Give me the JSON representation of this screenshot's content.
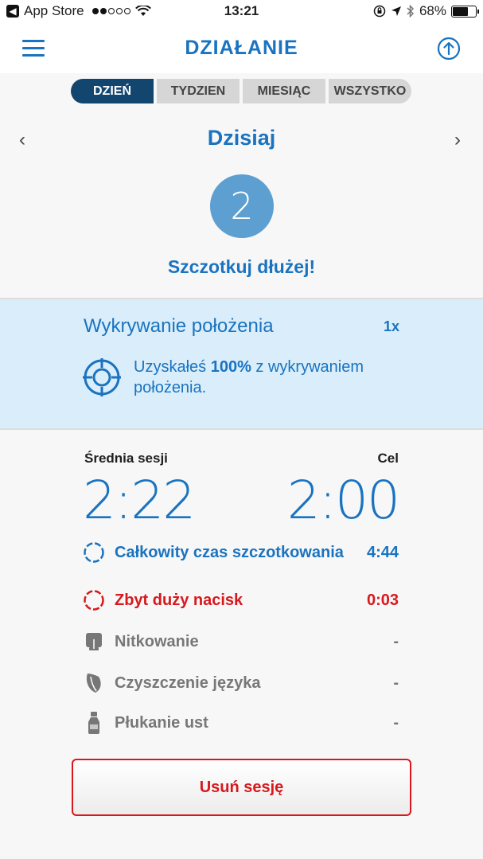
{
  "status_bar": {
    "app": "App Store",
    "time": "13:21",
    "battery": "68%"
  },
  "header": {
    "title": "DZIAŁANIE"
  },
  "tabs": [
    {
      "label": "DZIEŃ"
    },
    {
      "label": "TYDZIEN"
    },
    {
      "label": "MIESIĄC"
    },
    {
      "label": "WSZYSTKO"
    }
  ],
  "date": {
    "title": "Dzisiaj",
    "prev": "‹",
    "next": "›"
  },
  "score": {
    "value": "2",
    "tip": "Szczotkuj dłużej!"
  },
  "detection": {
    "title": "Wykrywanie położenia",
    "count": "1x",
    "text_prefix": "Uzyskałeś ",
    "text_bold": "100%",
    "text_suffix": " z wykrywaniem położenia."
  },
  "stats": {
    "avg_label": "Średnia sesji",
    "avg_value": "2:22",
    "goal_label": "Cel",
    "goal_value": "2:00",
    "rows": [
      {
        "label": "Całkowity czas szczotkowania",
        "value": "4:44",
        "icon": "dashed-circle-icon"
      },
      {
        "label": "Zbyt duży nacisk",
        "value": "0:03",
        "icon": "dashed-circle-icon"
      },
      {
        "label": "Nitkowanie",
        "value": "-",
        "icon": "floss-icon"
      },
      {
        "label": "Czyszczenie języka",
        "value": "-",
        "icon": "tongue-icon"
      },
      {
        "label": "Płukanie ust",
        "value": "-",
        "icon": "mouthwash-icon"
      }
    ]
  },
  "actions": {
    "delete_label": "Usuń sesję"
  },
  "colors": {
    "accent": "#1a73c0",
    "warning": "#d8181c",
    "tab_active": "#12466f",
    "panel": "#d9eefa"
  }
}
